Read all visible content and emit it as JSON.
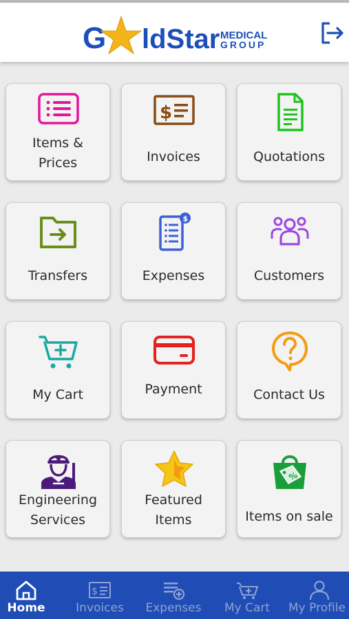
{
  "header": {
    "logo": {
      "brand_g": "G",
      "brand_rest": "ldStar",
      "sub_line1": "MEDICAL",
      "sub_line2": "GROUP"
    },
    "logout_icon": "logout-icon"
  },
  "tiles": [
    {
      "label_1": "Items &",
      "label_2": "Prices",
      "icon": "list-icon",
      "color": "#e3169a"
    },
    {
      "label": "Invoices",
      "icon": "invoice-icon",
      "color": "#8a4b12"
    },
    {
      "label": "Quotations",
      "icon": "document-icon",
      "color": "#1ec41e"
    },
    {
      "label": "Transfers",
      "icon": "folder-transfer-icon",
      "color": "#6b8e1a"
    },
    {
      "label": "Expenses",
      "icon": "receipt-icon",
      "color": "#3d5fd6"
    },
    {
      "label": "Customers",
      "icon": "users-icon",
      "color": "#9b47e0"
    },
    {
      "label": "My Cart",
      "icon": "cart-icon",
      "color": "#1aa8a0"
    },
    {
      "label": "Payment",
      "icon": "card-icon",
      "color": "#e32121"
    },
    {
      "label": "Contact Us",
      "icon": "question-bubble-icon",
      "color": "#f39c12"
    },
    {
      "label_1": "Engineering",
      "label_2": "Services",
      "icon": "engineer-icon",
      "color": "#4b1a7a"
    },
    {
      "label_1": "Featured",
      "label_2": "Items",
      "icon": "star-icon",
      "color": "#f5c518"
    },
    {
      "label": "Items on sale",
      "icon": "sale-bag-icon",
      "color": "#1a9e3a"
    }
  ],
  "bottom_nav": [
    {
      "label": "Home",
      "icon": "home-icon",
      "active": true
    },
    {
      "label": "Invoices",
      "icon": "invoice-icon",
      "active": false
    },
    {
      "label": "Expenses",
      "icon": "expenses-icon",
      "active": false
    },
    {
      "label": "My Cart",
      "icon": "cart-icon",
      "active": false
    },
    {
      "label": "My Profile",
      "icon": "profile-icon",
      "active": false
    }
  ]
}
